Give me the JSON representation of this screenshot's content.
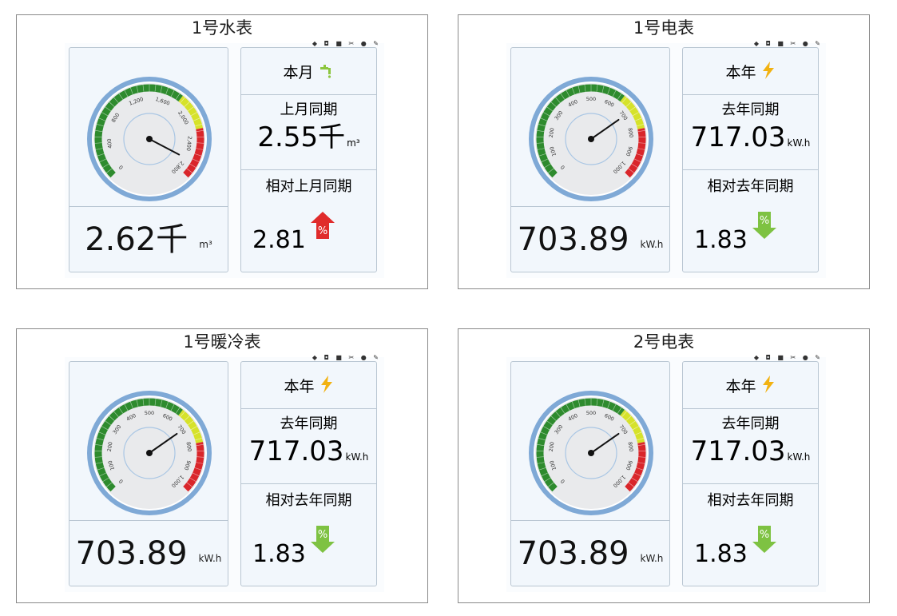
{
  "panels": [
    {
      "title": "1号水表",
      "gauge": {
        "min": 0,
        "max": 2800,
        "value": 2620,
        "ticks": [
          "0",
          "400",
          "800",
          "1,200",
          "1,600",
          "2,000",
          "2,400",
          "2,800"
        ]
      },
      "current": {
        "value": "2.62千",
        "unit": "m³"
      },
      "period": {
        "label": "本月",
        "icon": "water-tap-icon"
      },
      "previous": {
        "label": "上月同期",
        "value": "2.55千",
        "unit": "m³"
      },
      "relative": {
        "label": "相对上月同期",
        "value": "2.81",
        "icon": "percent-up-arrow-icon",
        "symbol": "%"
      }
    },
    {
      "title": "1号电表",
      "gauge": {
        "min": 0,
        "max": 1000,
        "value": 703.89,
        "ticks": [
          "0",
          "100",
          "200",
          "300",
          "400",
          "500",
          "600",
          "700",
          "800",
          "900",
          "1,000"
        ]
      },
      "current": {
        "value": "703.89",
        "unit": "kW.h"
      },
      "period": {
        "label": "本年",
        "icon": "lightning-icon"
      },
      "previous": {
        "label": "去年同期",
        "value": "717.03",
        "unit": "kW.h"
      },
      "relative": {
        "label": "相对去年同期",
        "value": "1.83",
        "icon": "percent-down-arrow-icon",
        "symbol": "%"
      }
    },
    {
      "title": "1号暖冷表",
      "gauge": {
        "min": 0,
        "max": 1000,
        "value": 703.89,
        "ticks": [
          "0",
          "100",
          "200",
          "300",
          "400",
          "500",
          "600",
          "700",
          "800",
          "900",
          "1,000"
        ]
      },
      "current": {
        "value": "703.89",
        "unit": "kW.h"
      },
      "period": {
        "label": "本年",
        "icon": "lightning-icon"
      },
      "previous": {
        "label": "去年同期",
        "value": "717.03",
        "unit": "kW.h"
      },
      "relative": {
        "label": "相对去年同期",
        "value": "1.83",
        "icon": "percent-down-arrow-icon",
        "symbol": "%"
      }
    },
    {
      "title": "2号电表",
      "gauge": {
        "min": 0,
        "max": 1000,
        "value": 703.89,
        "ticks": [
          "0",
          "100",
          "200",
          "300",
          "400",
          "500",
          "600",
          "700",
          "800",
          "900",
          "1,000"
        ]
      },
      "current": {
        "value": "703.89",
        "unit": "kW.h"
      },
      "period": {
        "label": "本年",
        "icon": "lightning-icon"
      },
      "previous": {
        "label": "去年同期",
        "value": "717.03",
        "unit": "kW.h"
      },
      "relative": {
        "label": "相对去年同期",
        "value": "1.83",
        "icon": "percent-down-arrow-icon",
        "symbol": "%"
      }
    }
  ],
  "toolbar_glyphs": "◆ ◘ ■ ✂ ● ✎",
  "colors": {
    "gauge_green": "#2e8b2e",
    "gauge_yellow": "#d6e22a",
    "gauge_red": "#d9262b",
    "gauge_bezel": "#7fa9d6",
    "arrow_up": "#e02b2b",
    "arrow_down": "#7ec242"
  }
}
